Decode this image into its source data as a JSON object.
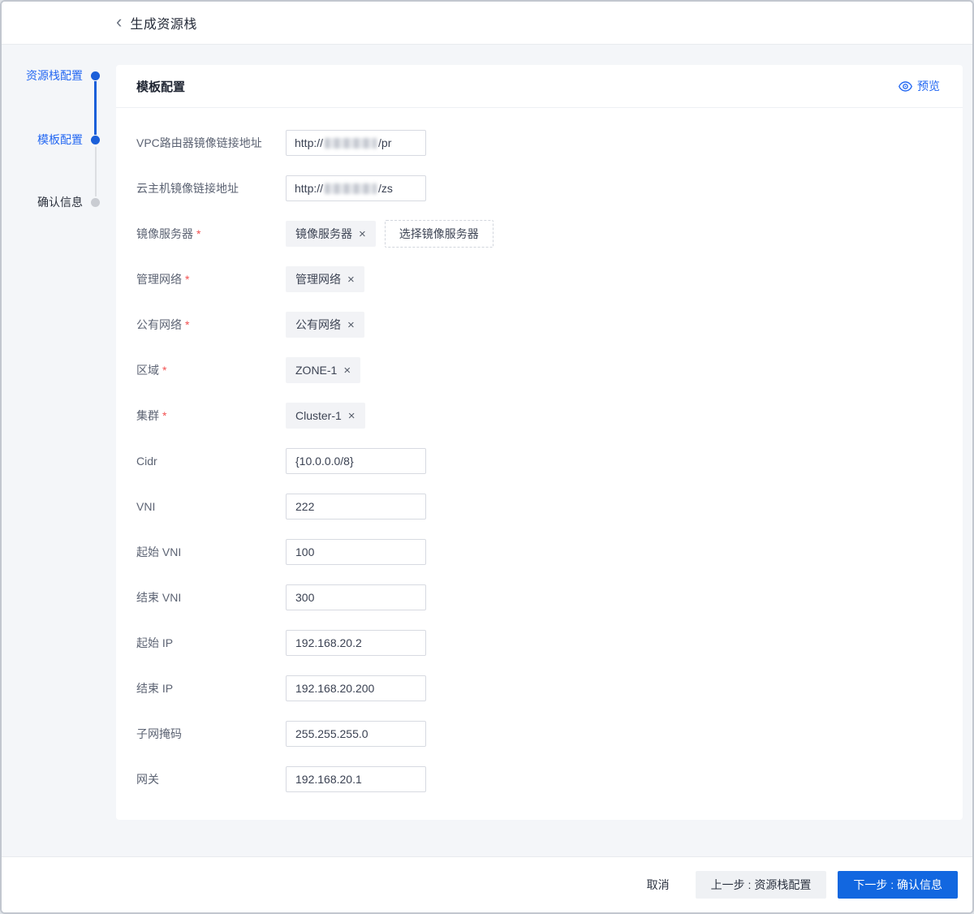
{
  "header": {
    "back_icon": "‹",
    "title": "生成资源栈"
  },
  "steps": [
    {
      "label": "资源栈配置",
      "state": "active"
    },
    {
      "label": "模板配置",
      "state": "active"
    },
    {
      "label": "确认信息",
      "state": "pending"
    }
  ],
  "panel": {
    "title": "模板配置",
    "preview_label": "预览"
  },
  "form": {
    "rows": [
      {
        "key": "vpc-router-image-url",
        "label": "VPC路由器镜像链接地址",
        "required": false,
        "control": "masked-url",
        "prefix": "http://",
        "suffix": "/pr",
        "masked": true
      },
      {
        "key": "host-image-url",
        "label": "云主机镜像链接地址",
        "required": false,
        "control": "masked-url",
        "prefix": "http://",
        "suffix": "/zs",
        "masked": true
      },
      {
        "key": "image-server",
        "label": "镜像服务器",
        "required": true,
        "control": "tag",
        "tag": "镜像服务器",
        "remove_icon": "×",
        "action": "选择镜像服务器"
      },
      {
        "key": "mgmt-network",
        "label": "管理网络",
        "required": true,
        "control": "tag",
        "tag": "管理网络",
        "remove_icon": "×"
      },
      {
        "key": "public-network",
        "label": "公有网络",
        "required": true,
        "control": "tag",
        "tag": "公有网络",
        "remove_icon": "×"
      },
      {
        "key": "zone",
        "label": "区域",
        "required": true,
        "control": "tag",
        "tag": "ZONE-1",
        "remove_icon": "×"
      },
      {
        "key": "cluster",
        "label": "集群",
        "required": true,
        "control": "tag",
        "tag": "Cluster-1",
        "remove_icon": "×"
      },
      {
        "key": "cidr",
        "label": "Cidr",
        "required": false,
        "control": "input",
        "value": "{10.0.0.0/8}",
        "extra_gap": true
      },
      {
        "key": "vni",
        "label": "VNI",
        "required": false,
        "control": "input",
        "value": "222"
      },
      {
        "key": "start-vni",
        "label": "起始 VNI",
        "required": false,
        "control": "input",
        "value": "100"
      },
      {
        "key": "end-vni",
        "label": "结束 VNI",
        "required": false,
        "control": "input",
        "value": "300"
      },
      {
        "key": "start-ip",
        "label": "起始 IP",
        "required": false,
        "control": "input",
        "value": "192.168.20.2"
      },
      {
        "key": "end-ip",
        "label": "结束 IP",
        "required": false,
        "control": "input",
        "value": "192.168.20.200"
      },
      {
        "key": "netmask",
        "label": "子网掩码",
        "required": false,
        "control": "input",
        "value": "255.255.255.0"
      },
      {
        "key": "gateway",
        "label": "网关",
        "required": false,
        "control": "input",
        "value": "192.168.20.1"
      }
    ]
  },
  "footer": {
    "cancel": "取消",
    "prev": "上一步 : 资源栈配置",
    "next": "下一步 : 确认信息"
  },
  "colors": {
    "accent_link": "#2468f2",
    "primary_button": "#1267e0",
    "step_dot_active": "#1b5fd9",
    "step_dot_pending": "#c9ccd2",
    "required_asterisk": "#f25050",
    "content_background": "#f4f6f9"
  }
}
